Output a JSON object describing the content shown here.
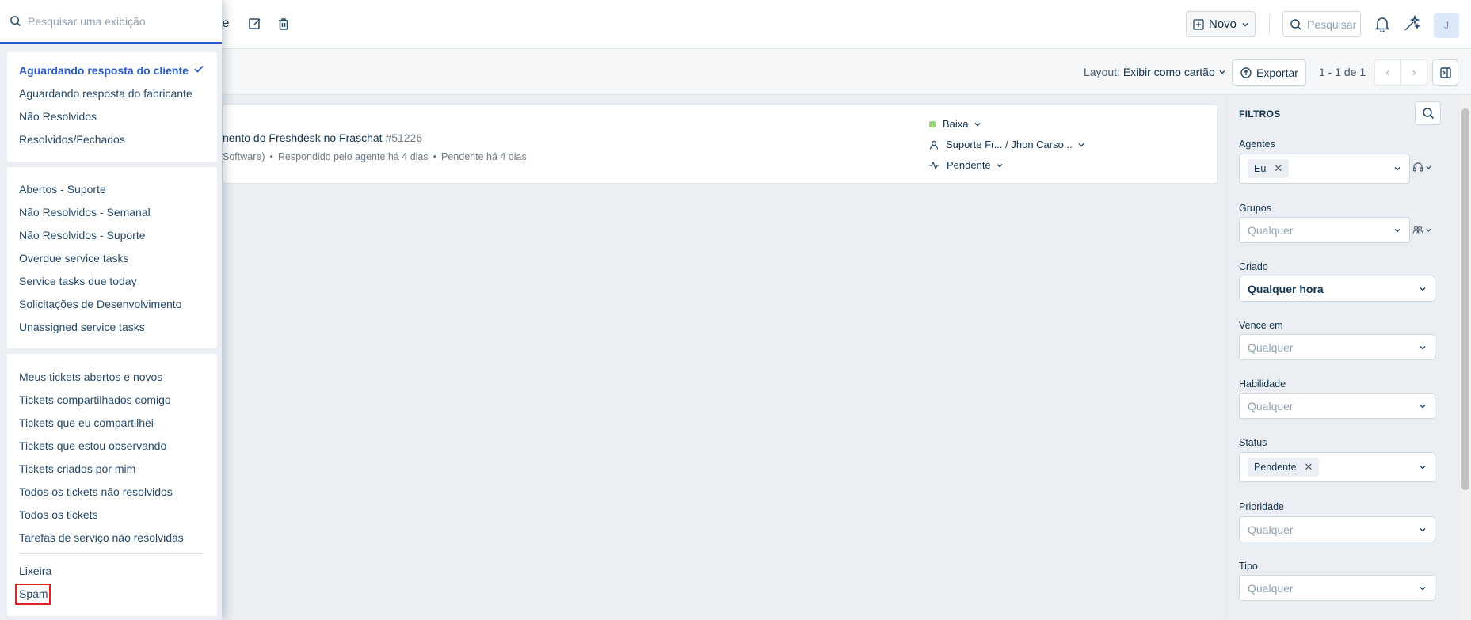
{
  "topbar": {
    "title_fragment": "te",
    "new_button": "Novo",
    "search_label": "Pesquisar",
    "avatar_initial": "J"
  },
  "subbar": {
    "layout_label": "Layout:",
    "layout_value": "Exibir como cartão",
    "export_label": "Exportar",
    "pagination": "1 - 1 de 1"
  },
  "ticket": {
    "subject_fragment": "nento do Freshdesk no Fraschat",
    "number": "#51226",
    "meta_company": "Software)",
    "meta_responded": "Respondido pelo agente há 4 dias",
    "meta_pending": "Pendente há 4 dias",
    "priority": "Baixa",
    "assignee": "Suporte Fr... / Jhon Carso...",
    "status": "Pendente",
    "priority_color": "#97d479"
  },
  "filters": {
    "title": "FILTROS",
    "agents_label": "Agentes",
    "agents_chip": "Eu",
    "groups_label": "Grupos",
    "groups_placeholder": "Qualquer",
    "created_label": "Criado",
    "created_value": "Qualquer hora",
    "due_label": "Vence em",
    "due_placeholder": "Qualquer",
    "skill_label": "Habilidade",
    "skill_placeholder": "Qualquer",
    "status_label": "Status",
    "status_chip": "Pendente",
    "priority_label": "Prioridade",
    "priority_placeholder": "Qualquer",
    "type_label": "Tipo",
    "type_placeholder": "Qualquer"
  },
  "views": {
    "search_placeholder": "Pesquisar uma exibição",
    "group1": [
      "Aguardando resposta do cliente",
      "Aguardando resposta do fabricante",
      "Não Resolvidos",
      "Resolvidos/Fechados"
    ],
    "group2": [
      "Abertos - Suporte",
      "Não Resolvidos - Semanal",
      "Não Resolvidos - Suporte",
      "Overdue service tasks",
      "Service tasks due today",
      "Solicitações de Desenvolvimento",
      "Unassigned service tasks"
    ],
    "group3": [
      "Meus tickets abertos e novos",
      "Tickets compartilhados comigo",
      "Tickets que eu compartilhei",
      "Tickets que estou observando",
      "Tickets criados por mim",
      "Todos os tickets não resolvidos",
      "Todos os tickets",
      "Tarefas de serviço não resolvidas"
    ],
    "group4": [
      "Lixeira",
      "Spam"
    ],
    "highlight_color": "#e52020",
    "accent_color": "#2c5cc5"
  }
}
